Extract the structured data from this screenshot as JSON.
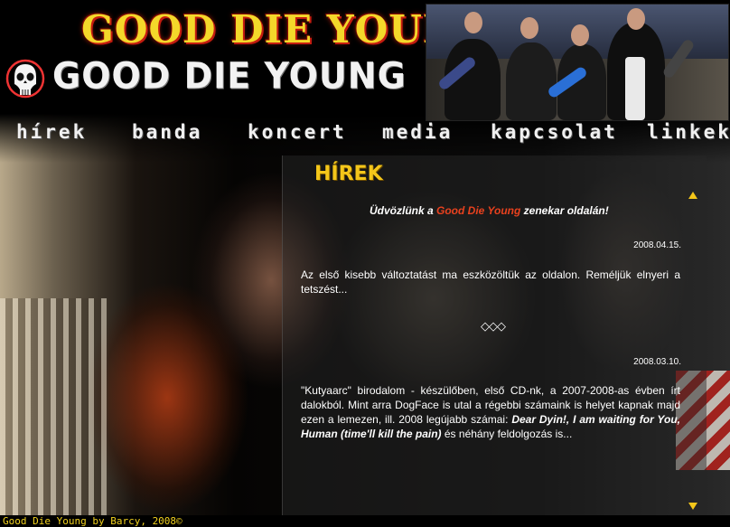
{
  "header": {
    "top_logo": "GOOD DIE YOUNG",
    "sub_logo": "GOOD DIE YOUNG"
  },
  "nav": [
    {
      "label": "hírek"
    },
    {
      "label": "banda"
    },
    {
      "label": "koncert"
    },
    {
      "label": "media"
    },
    {
      "label": "kapcsolat"
    },
    {
      "label": "linkek"
    }
  ],
  "content": {
    "section_title": "HÍREK",
    "welcome_prefix": "Üdvözlünk a ",
    "welcome_brand": "Good Die Young",
    "welcome_suffix": " zenekar oldalán!",
    "posts": [
      {
        "date": "2008.04.15.",
        "text": "Az első kisebb változtatást ma eszközöltük az oldalon.  Reméljük elnyeri a tetszést..."
      },
      {
        "date": "2008.03.10.",
        "text_a": "\"Kutyaarc\" birodalom - készülőben, első CD-nk, a 2007-2008-as évben írt dalokból. Mint arra DogFace is utal a régebbi számaink is helyet kapnak majd ezen a lemezen, ill. 2008 legújabb számai: ",
        "songs": "Dear Dyin!, I am waiting for You, Human (time'll kill the pain)",
        "text_b": " és néhány feldolgozás is..."
      }
    ],
    "separator": "◇◇◇"
  },
  "footer": {
    "text": "Good Die Young by Barcy, 2008©"
  },
  "colors": {
    "accent_yellow": "#f4c61a",
    "brand_red": "#e8411e",
    "footer_text": "#f2d21e"
  }
}
